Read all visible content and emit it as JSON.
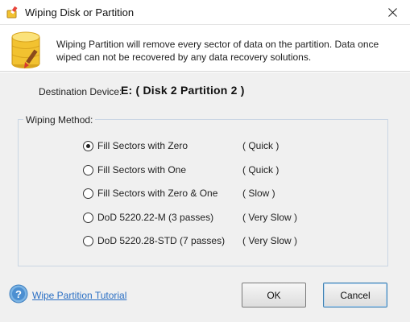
{
  "window": {
    "title": "Wiping Disk or Partition",
    "icons": {
      "app": "eraser-disk-icon",
      "close": "close-icon"
    }
  },
  "header": {
    "icon": "database-brush-icon",
    "message": "Wiping Partition will remove every sector of data on the partition. Data once wiped can not be recovered by any data recovery solutions."
  },
  "destination": {
    "label": "Destination Device:",
    "value": "E: ( Disk 2 Partition 2 )"
  },
  "wiping_method": {
    "legend": "Wiping Method:",
    "selected_index": 0,
    "options": [
      {
        "label": "Fill Sectors with Zero",
        "speed": "( Quick )",
        "checked": true
      },
      {
        "label": "Fill Sectors with One",
        "speed": "( Quick )",
        "checked": false
      },
      {
        "label": "Fill Sectors with Zero & One",
        "speed": "( Slow )",
        "checked": false
      },
      {
        "label": "DoD 5220.22-M (3 passes)",
        "speed": "( Very Slow )",
        "checked": false
      },
      {
        "label": "DoD 5220.28-STD (7 passes)",
        "speed": "( Very Slow )",
        "checked": false
      }
    ]
  },
  "footer": {
    "help_icon": "help-icon",
    "tutorial_link": "Wipe Partition Tutorial",
    "ok_label": "OK",
    "cancel_label": "Cancel"
  },
  "colors": {
    "link": "#2a6fc4",
    "content_background": "#f0f0f0",
    "group_border": "#c9d5e3",
    "db_gold": "#f2c230"
  }
}
